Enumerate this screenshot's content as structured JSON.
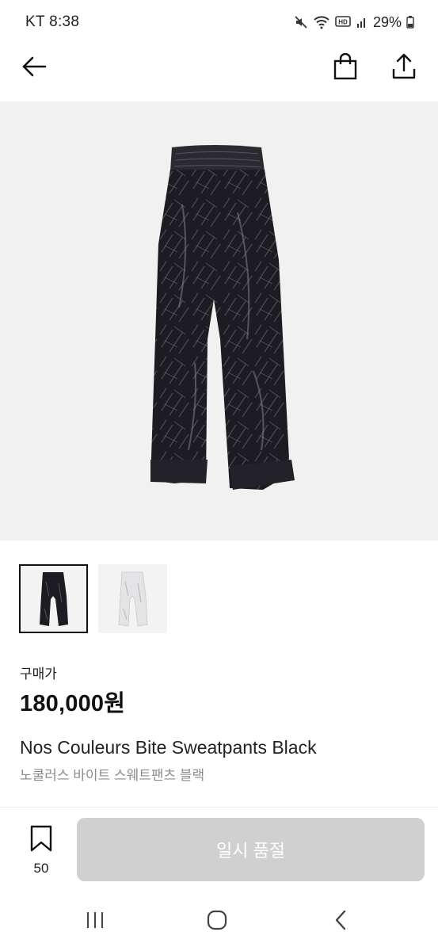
{
  "status_bar": {
    "carrier_time": "KT 8:38",
    "battery": "29%",
    "icons": [
      "mute-icon",
      "wifi-icon",
      "hd-icon",
      "signal-icon",
      "battery-icon"
    ]
  },
  "top_bar": {
    "icons": [
      "back-arrow-icon",
      "shopping-bag-icon",
      "share-icon"
    ]
  },
  "product": {
    "image_alt_colors": [
      "#1a1a1e",
      "#f1f1f1"
    ],
    "thumbnails": [
      {
        "variant": "black",
        "selected": true
      },
      {
        "variant": "white",
        "selected": false
      }
    ],
    "price_label": "구매가",
    "price": "180,000원",
    "name_en": "Nos Couleurs Bite Sweatpants Black",
    "name_ko": "노쿨러스 바이트 스웨트팬츠 블랙"
  },
  "bottom_action": {
    "wish_count": "50",
    "buy_label": "일시 품절",
    "buy_color": "#d0d0d0"
  },
  "nav_bar": {
    "icons": [
      "recent-apps-icon",
      "home-icon",
      "nav-back-icon"
    ]
  }
}
